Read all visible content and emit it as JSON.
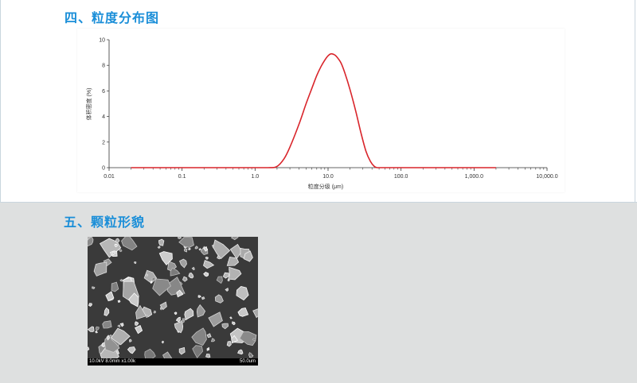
{
  "headings": {
    "distribution": "四、粒度分布图",
    "morphology": "五、颗粒形貌"
  },
  "colors": {
    "heading": "#1a8ed8",
    "curve": "#d9252b",
    "section2_bg": "#dee0e0"
  },
  "sem_image": {
    "info_text": "10.0kV 8.0mm x1.00k",
    "scale_text": "50.0um"
  },
  "chart_data": {
    "type": "line",
    "xlabel": "粒度分级 (μm)",
    "ylabel": "体积密度 (%)",
    "xscale": "log",
    "xlim": [
      0.01,
      10000
    ],
    "ylim": [
      0,
      10
    ],
    "xticks": [
      {
        "v": 0.01,
        "label": "0.01"
      },
      {
        "v": 0.1,
        "label": "0.1"
      },
      {
        "v": 1,
        "label": "1.0"
      },
      {
        "v": 10,
        "label": "10.0"
      },
      {
        "v": 100,
        "label": "100.0"
      },
      {
        "v": 1000,
        "label": "1,000.0"
      },
      {
        "v": 10000,
        "label": "10,000.0"
      }
    ],
    "yticks": [
      0,
      2,
      4,
      6,
      8,
      10
    ],
    "grid": false,
    "series": [
      {
        "x": [
          0.02,
          0.1,
          0.5,
          1.5,
          2.0,
          2.5,
          3.0,
          4.0,
          5.0,
          6.0,
          7.0,
          8.0,
          9.0,
          10.0,
          11.0,
          12.0,
          13.0,
          15.0,
          17.0,
          20.0,
          24.0,
          28.0,
          33.0,
          38.0,
          43.0,
          47.0,
          55.0,
          100.0,
          500.0,
          1000.0,
          2000.0
        ],
        "y": [
          0,
          0,
          0,
          0,
          0.1,
          0.7,
          1.6,
          3.4,
          5.0,
          6.2,
          7.2,
          7.9,
          8.4,
          8.75,
          8.9,
          8.85,
          8.7,
          8.2,
          7.4,
          6.1,
          4.4,
          2.8,
          1.3,
          0.5,
          0.1,
          0,
          0,
          0,
          0,
          0,
          0
        ]
      }
    ]
  }
}
